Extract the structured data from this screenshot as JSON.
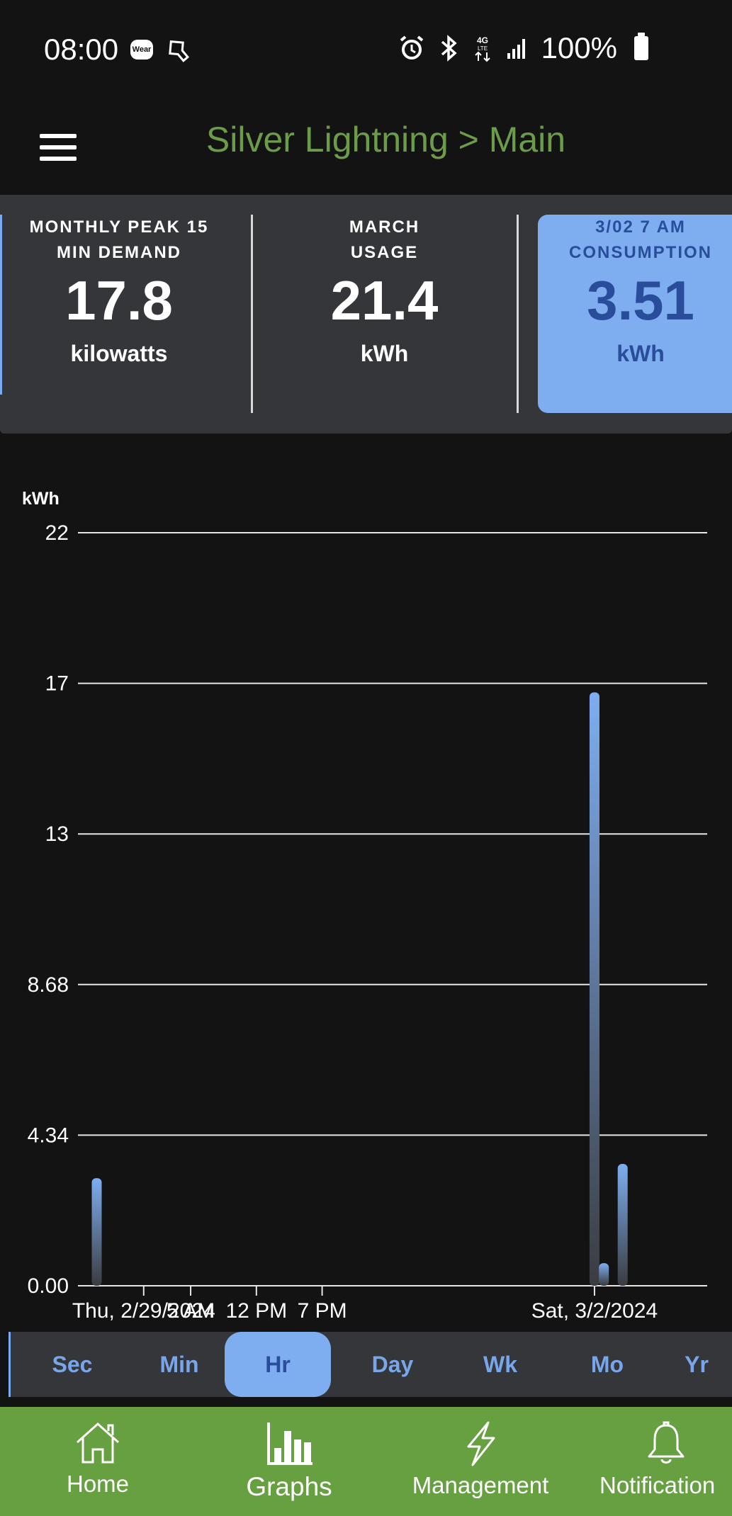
{
  "status_bar": {
    "time": "08:00",
    "wear_label": "Wear",
    "battery": "100%",
    "icons": [
      "wear-icon",
      "flashlight-icon",
      "alarm-icon",
      "bluetooth-icon",
      "4g-lte-icon",
      "signal-icon",
      "battery-icon"
    ]
  },
  "app_bar": {
    "title": "Silver Lightning > Main",
    "menu_icon": "hamburger-menu-icon"
  },
  "cards": [
    {
      "label_line1": "MONTHLY PEAK 15",
      "label_line2": "MIN DEMAND",
      "value": "17.8",
      "unit": "kilowatts"
    },
    {
      "label_line1": "MARCH",
      "label_line2": "USAGE",
      "value": "21.4",
      "unit": "kWh"
    },
    {
      "label_line1": "3/02 7 AM",
      "label_line2": "CONSUMPTION",
      "value": "3.51",
      "unit": "kWh"
    }
  ],
  "chart_data": {
    "type": "bar",
    "ylabel": "kWh",
    "yticks": [
      "22",
      "17",
      "13",
      "8.68",
      "4.34",
      "0.00"
    ],
    "ytick_values": [
      21.7,
      17.36,
      13.02,
      8.68,
      4.34,
      0
    ],
    "ylim": [
      0,
      21.7
    ],
    "xlim_hours": [
      -7,
      60
    ],
    "xticks": [
      {
        "label": "Thu, 2/29/2024",
        "hour": 0
      },
      {
        "label": "5 AM",
        "hour": 5
      },
      {
        "label": "12 PM",
        "hour": 12
      },
      {
        "label": "7 PM",
        "hour": 19
      },
      {
        "label": "Sat, 3/2/2024",
        "hour": 48
      }
    ],
    "bars": [
      {
        "hour": -5,
        "value": 3.1
      },
      {
        "hour": 48,
        "value": 17.1
      },
      {
        "hour": 49,
        "value": 0.65
      },
      {
        "hour": 51,
        "value": 3.51
      }
    ],
    "bar_color": "#7eaef0",
    "grid": true
  },
  "range_tabs": {
    "items": [
      "Sec",
      "Min",
      "Hr",
      "Day",
      "Wk",
      "Mo",
      "Yr"
    ],
    "active": "Hr"
  },
  "bottom_nav": {
    "items": [
      {
        "label": "Home",
        "icon": "home-icon"
      },
      {
        "label": "Graphs",
        "icon": "bar-chart-icon"
      },
      {
        "label": "Management",
        "icon": "lightning-icon"
      },
      {
        "label": "Notification",
        "icon": "bell-icon"
      }
    ],
    "active": "Graphs",
    "color": "#67a040"
  }
}
